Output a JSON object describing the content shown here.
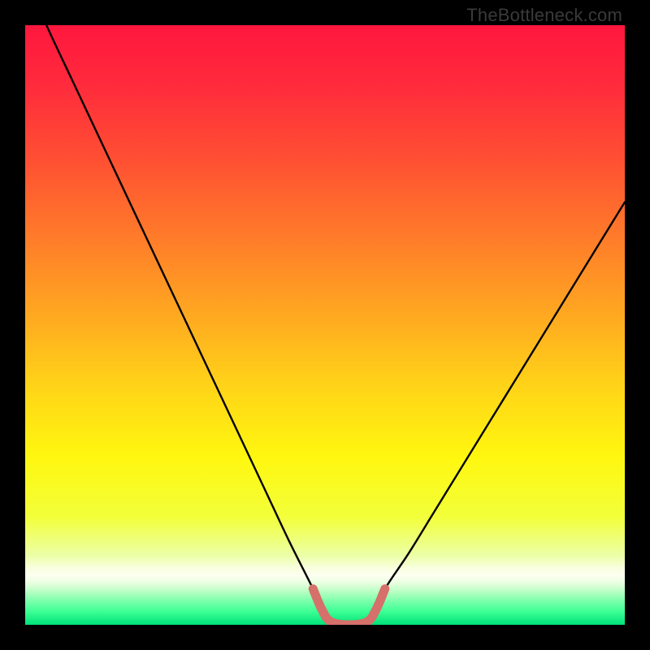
{
  "watermark": "TheBottleneck.com",
  "colors": {
    "frame": "#000000",
    "curve": "#000000",
    "highlight": "#d6706a",
    "gradient_stops": [
      {
        "offset": 0.0,
        "color": "#ff173e"
      },
      {
        "offset": 0.1,
        "color": "#ff2b3c"
      },
      {
        "offset": 0.22,
        "color": "#ff4e33"
      },
      {
        "offset": 0.35,
        "color": "#ff7a2a"
      },
      {
        "offset": 0.48,
        "color": "#ffa721"
      },
      {
        "offset": 0.6,
        "color": "#ffd318"
      },
      {
        "offset": 0.72,
        "color": "#fff70f"
      },
      {
        "offset": 0.82,
        "color": "#f2ff3a"
      },
      {
        "offset": 0.885,
        "color": "#ecffa8"
      },
      {
        "offset": 0.905,
        "color": "#f8ffde"
      },
      {
        "offset": 0.918,
        "color": "#fdfff1"
      },
      {
        "offset": 0.93,
        "color": "#e9ffe0"
      },
      {
        "offset": 0.945,
        "color": "#b7ffc3"
      },
      {
        "offset": 0.96,
        "color": "#7cffab"
      },
      {
        "offset": 0.978,
        "color": "#3cff93"
      },
      {
        "offset": 1.0,
        "color": "#00e17a"
      }
    ]
  },
  "chart_data": {
    "type": "line",
    "title": "",
    "xlabel": "",
    "ylabel": "",
    "xlim": [
      0,
      100
    ],
    "ylim": [
      0,
      100
    ],
    "grid": false,
    "legend": false,
    "series": [
      {
        "name": "bottleneck-curve",
        "x": [
          0,
          4,
          8,
          12,
          16,
          20,
          24,
          28,
          32,
          36,
          40,
          44,
          48,
          49.5,
          51,
          54,
          57,
          58.5,
          60,
          64,
          68,
          72,
          76,
          80,
          84,
          88,
          92,
          96,
          100
        ],
        "y": [
          108,
          99,
          90.5,
          82,
          73.5,
          65,
          56.5,
          48,
          39.5,
          31,
          22.5,
          14,
          6,
          2.5,
          0.5,
          0,
          0.5,
          2.5,
          6,
          12,
          18.5,
          25,
          31.5,
          38,
          44.5,
          51,
          57.5,
          64,
          70.5
        ]
      },
      {
        "name": "highlight-segment",
        "x": [
          48,
          49.5,
          51,
          54,
          57,
          58.5,
          60
        ],
        "y": [
          6,
          2.5,
          0.5,
          0,
          0.5,
          2.5,
          6
        ]
      }
    ]
  }
}
